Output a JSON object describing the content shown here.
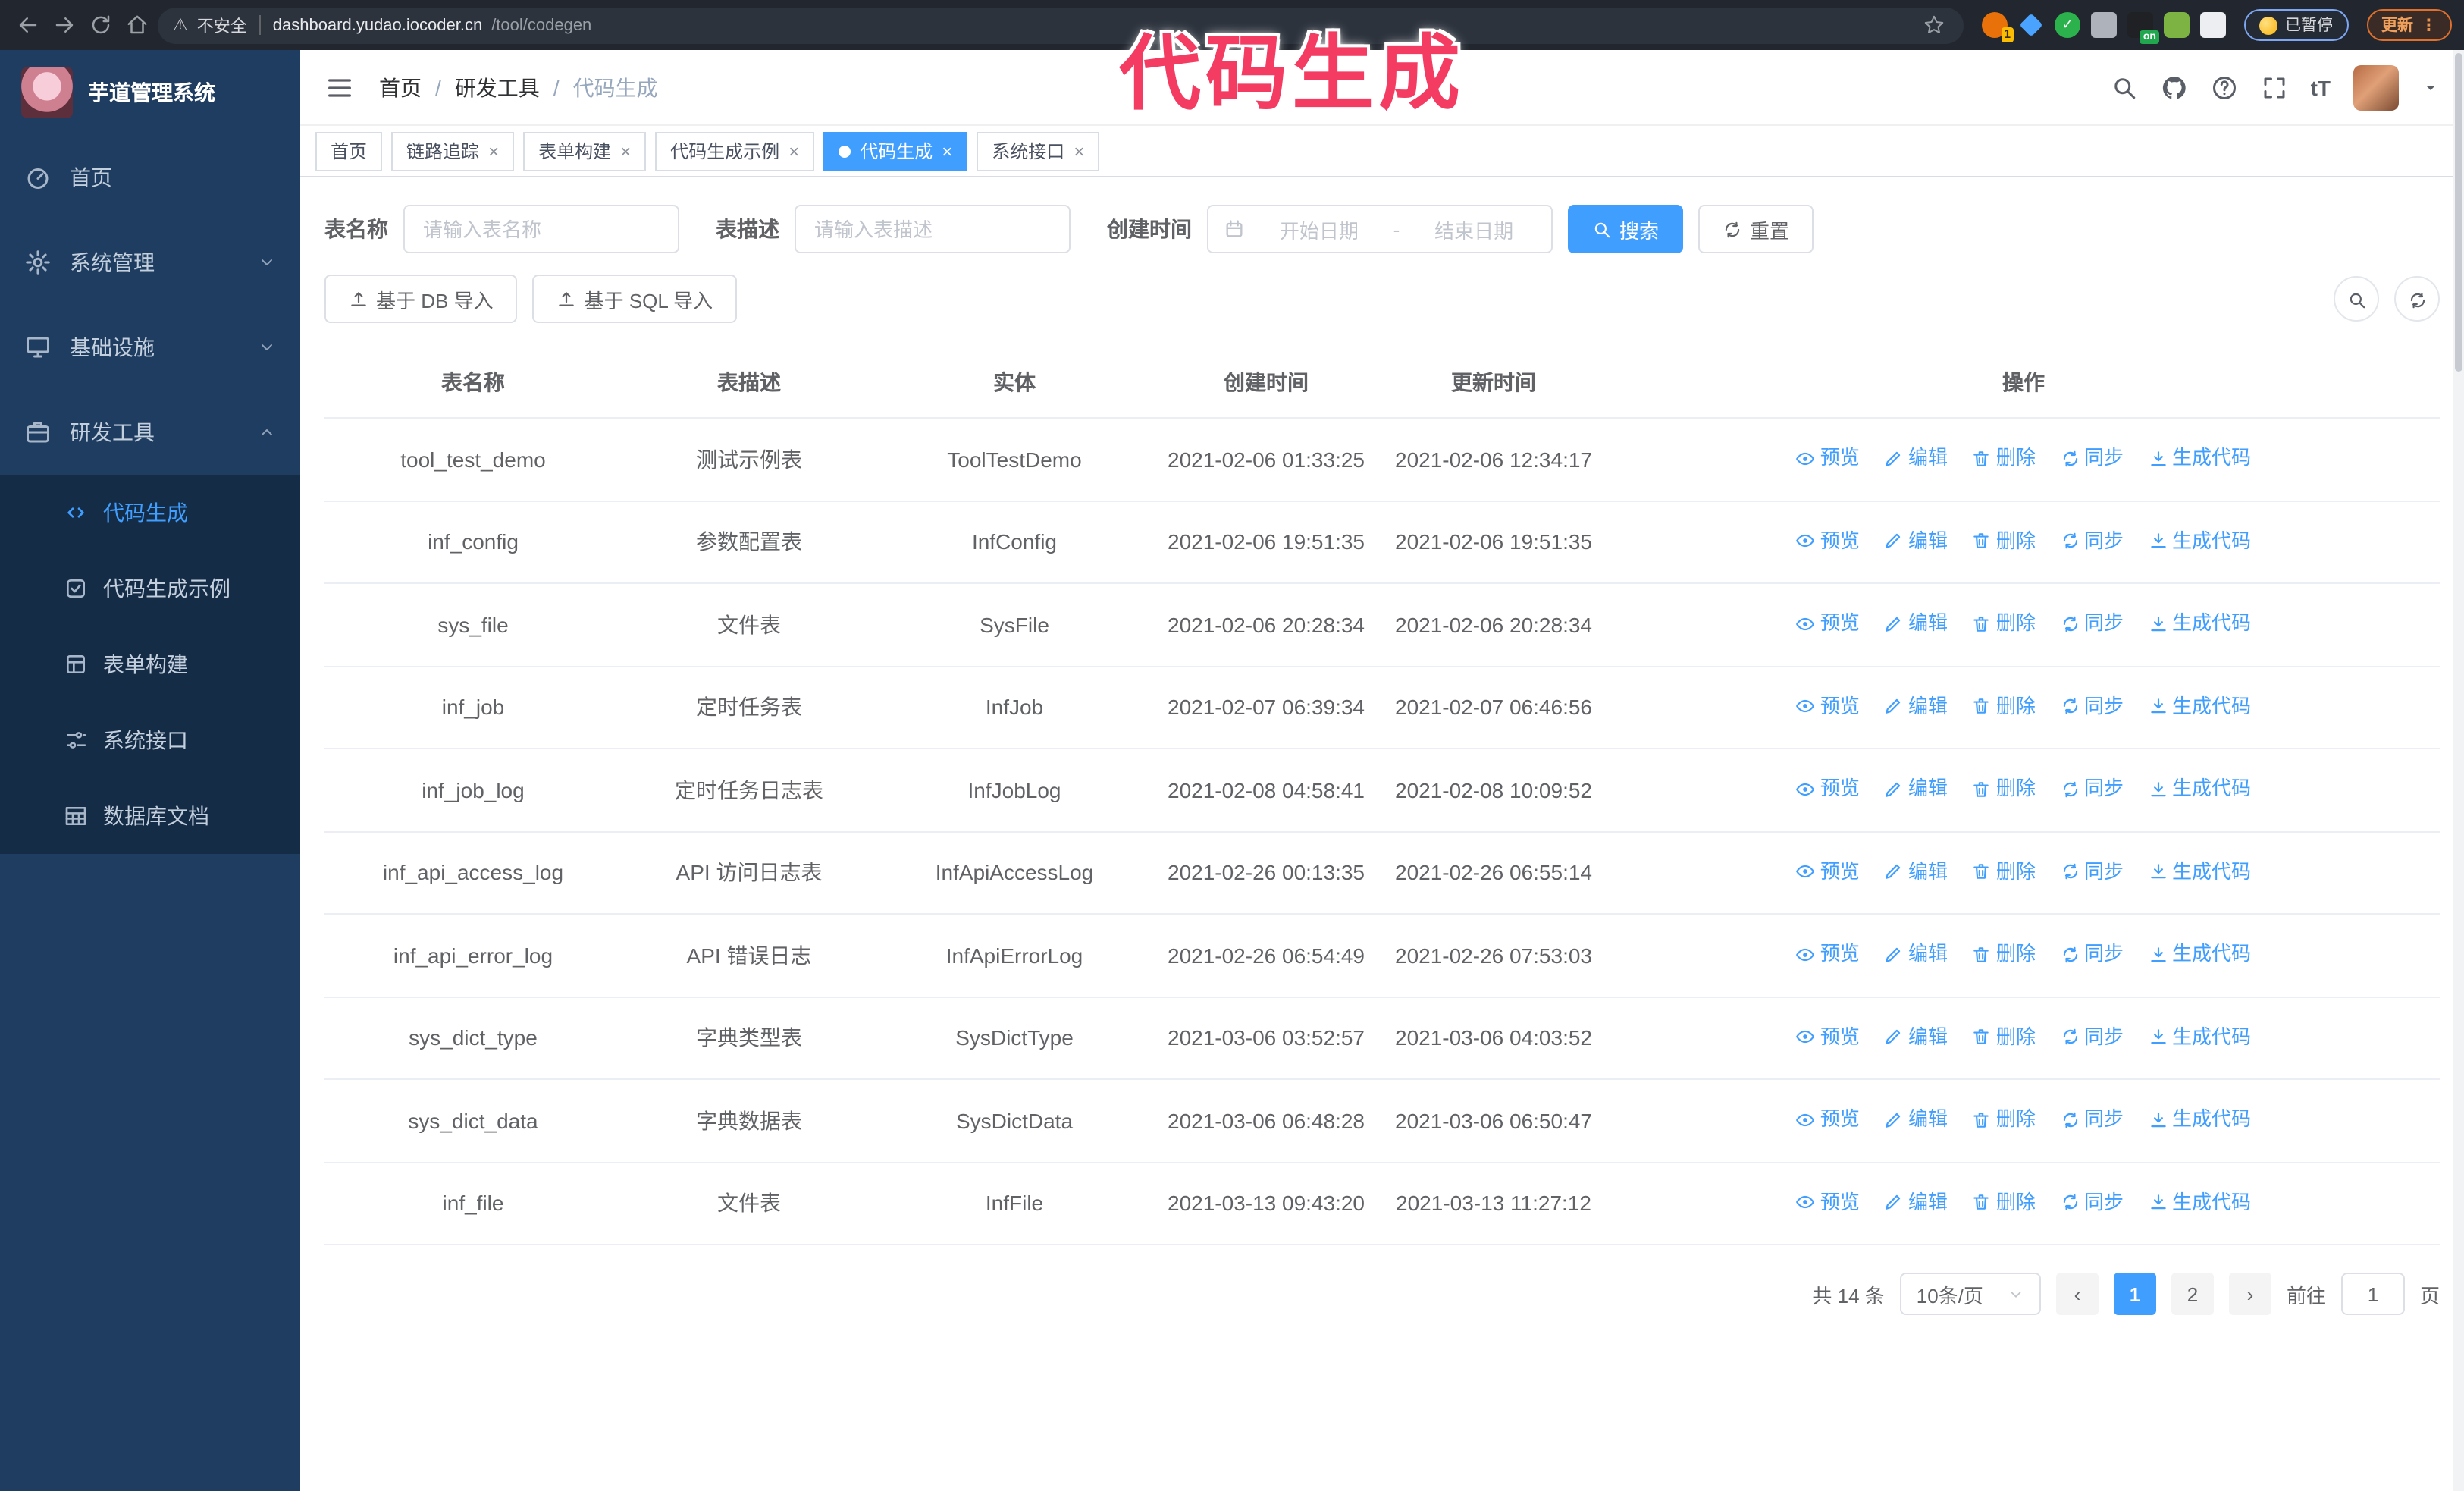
{
  "watermark": "代码生成",
  "browser": {
    "security_label": "不安全",
    "url_host": "dashboard.yudao.iocoder.cn",
    "url_path": "/tool/codegen",
    "extension_badge": "1",
    "on_badge": "on",
    "paused_label": "已暂停",
    "update_label": "更新"
  },
  "sidebar": {
    "logo_title": "芋道管理系统",
    "items": [
      {
        "label": "首页"
      },
      {
        "label": "系统管理"
      },
      {
        "label": "基础设施"
      },
      {
        "label": "研发工具"
      }
    ],
    "submenu": [
      {
        "label": "代码生成",
        "active": true
      },
      {
        "label": "代码生成示例",
        "active": false
      },
      {
        "label": "表单构建",
        "active": false
      },
      {
        "label": "系统接口",
        "active": false
      },
      {
        "label": "数据库文档",
        "active": false
      }
    ]
  },
  "navbar": {
    "breadcrumb": [
      "首页",
      "研发工具",
      "代码生成"
    ]
  },
  "tabs": [
    {
      "label": "首页",
      "active": false,
      "closable": false
    },
    {
      "label": "链路追踪",
      "active": false,
      "closable": true
    },
    {
      "label": "表单构建",
      "active": false,
      "closable": true
    },
    {
      "label": "代码生成示例",
      "active": false,
      "closable": true
    },
    {
      "label": "代码生成",
      "active": true,
      "closable": true
    },
    {
      "label": "系统接口",
      "active": false,
      "closable": true
    }
  ],
  "search": {
    "name_label": "表名称",
    "name_placeholder": "请输入表名称",
    "desc_label": "表描述",
    "desc_placeholder": "请输入表描述",
    "time_label": "创建时间",
    "start_placeholder": "开始日期",
    "range_separator": "-",
    "end_placeholder": "结束日期",
    "search_button": "搜索",
    "reset_button": "重置"
  },
  "toolbar": {
    "import_db_button": "基于 DB 导入",
    "import_sql_button": "基于 SQL 导入"
  },
  "table": {
    "columns": [
      "表名称",
      "表描述",
      "实体",
      "创建时间",
      "更新时间",
      "操作"
    ],
    "actions": [
      "预览",
      "编辑",
      "删除",
      "同步",
      "生成代码"
    ],
    "action_icons": [
      "eye-icon",
      "edit-icon",
      "delete-icon",
      "sync-icon",
      "download-icon"
    ],
    "rows": [
      {
        "name": "tool_test_demo",
        "desc": "测试示例表",
        "entity": "ToolTestDemo",
        "created": "2021-02-06 01:33:25",
        "updated": "2021-02-06 12:34:17"
      },
      {
        "name": "inf_config",
        "desc": "参数配置表",
        "entity": "InfConfig",
        "created": "2021-02-06 19:51:35",
        "updated": "2021-02-06 19:51:35"
      },
      {
        "name": "sys_file",
        "desc": "文件表",
        "entity": "SysFile",
        "created": "2021-02-06 20:28:34",
        "updated": "2021-02-06 20:28:34"
      },
      {
        "name": "inf_job",
        "desc": "定时任务表",
        "entity": "InfJob",
        "created": "2021-02-07 06:39:34",
        "updated": "2021-02-07 06:46:56"
      },
      {
        "name": "inf_job_log",
        "desc": "定时任务日志表",
        "entity": "InfJobLog",
        "created": "2021-02-08 04:58:41",
        "updated": "2021-02-08 10:09:52"
      },
      {
        "name": "inf_api_access_log",
        "desc": "API 访问日志表",
        "entity": "InfApiAccessLog",
        "created": "2021-02-26 00:13:35",
        "updated": "2021-02-26 06:55:14"
      },
      {
        "name": "inf_api_error_log",
        "desc": "API 错误日志",
        "entity": "InfApiErrorLog",
        "created": "2021-02-26 06:54:49",
        "updated": "2021-02-26 07:53:03"
      },
      {
        "name": "sys_dict_type",
        "desc": "字典类型表",
        "entity": "SysDictType",
        "created": "2021-03-06 03:52:57",
        "updated": "2021-03-06 04:03:52"
      },
      {
        "name": "sys_dict_data",
        "desc": "字典数据表",
        "entity": "SysDictData",
        "created": "2021-03-06 06:48:28",
        "updated": "2021-03-06 06:50:47"
      },
      {
        "name": "inf_file",
        "desc": "文件表",
        "entity": "InfFile",
        "created": "2021-03-13 09:43:20",
        "updated": "2021-03-13 11:27:12"
      }
    ]
  },
  "pagination": {
    "total": "共 14 条",
    "page_size": "10条/页",
    "pages": [
      "1",
      "2"
    ],
    "active_page": "1",
    "goto_label": "前往",
    "goto_value": "1",
    "page_suffix": "页"
  },
  "colors": {
    "primary": "#409eff",
    "watermark_pink": "#f43b62",
    "sidebar_bg": "#1e3d61",
    "submenu_bg": "#152c47"
  }
}
